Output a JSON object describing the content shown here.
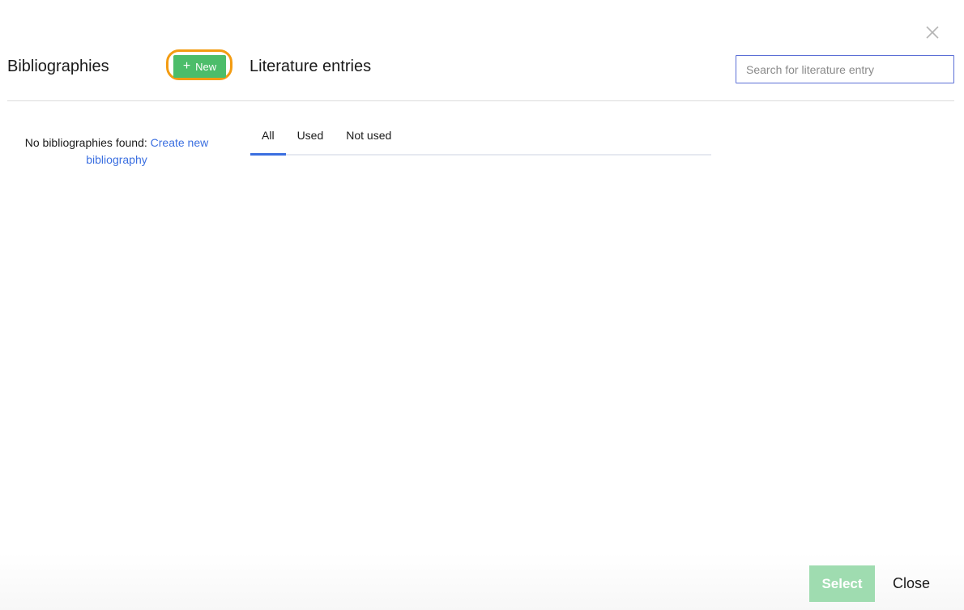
{
  "header": {
    "bibliographies_title": "Bibliographies",
    "new_button_label": "New",
    "literature_title": "Literature entries",
    "search": {
      "placeholder": "Search for literature entry",
      "value": ""
    }
  },
  "left_panel": {
    "empty_text": "No bibliographies found: ",
    "create_link": "Create new bibliography"
  },
  "tabs": [
    {
      "label": "All",
      "active": true
    },
    {
      "label": "Used",
      "active": false
    },
    {
      "label": "Not used",
      "active": false
    }
  ],
  "footer": {
    "select_label": "Select",
    "close_label": "Close"
  },
  "icons": {
    "close": "close-icon",
    "new": "plus-icon"
  },
  "colors": {
    "accent_blue": "#3b6fe0",
    "new_button_green": "#4cbd6a",
    "select_button_disabled": "#9fdcb0",
    "highlight_orange": "#f39c12"
  }
}
